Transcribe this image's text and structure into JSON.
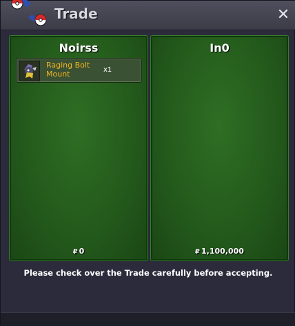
{
  "window": {
    "title": "Trade",
    "close_icon": "close-icon",
    "logo_icon": "pokeball-logo-icon"
  },
  "left_panel": {
    "player_name": "Noirss",
    "money": "0",
    "currency_icon": "coin-icon",
    "items": [
      {
        "name": "Raging Bolt Mount",
        "qty": "x1",
        "icon": "raging-bolt-icon"
      }
    ]
  },
  "right_panel": {
    "player_name": "In0",
    "money": "1,100,000",
    "currency_icon": "coin-icon",
    "items": []
  },
  "notice": "Please check over the Trade carefully before accepting.",
  "colors": {
    "panel_green": "#2a6320",
    "item_name": "#f2b51f",
    "window_bg": "#2b2b3c"
  }
}
